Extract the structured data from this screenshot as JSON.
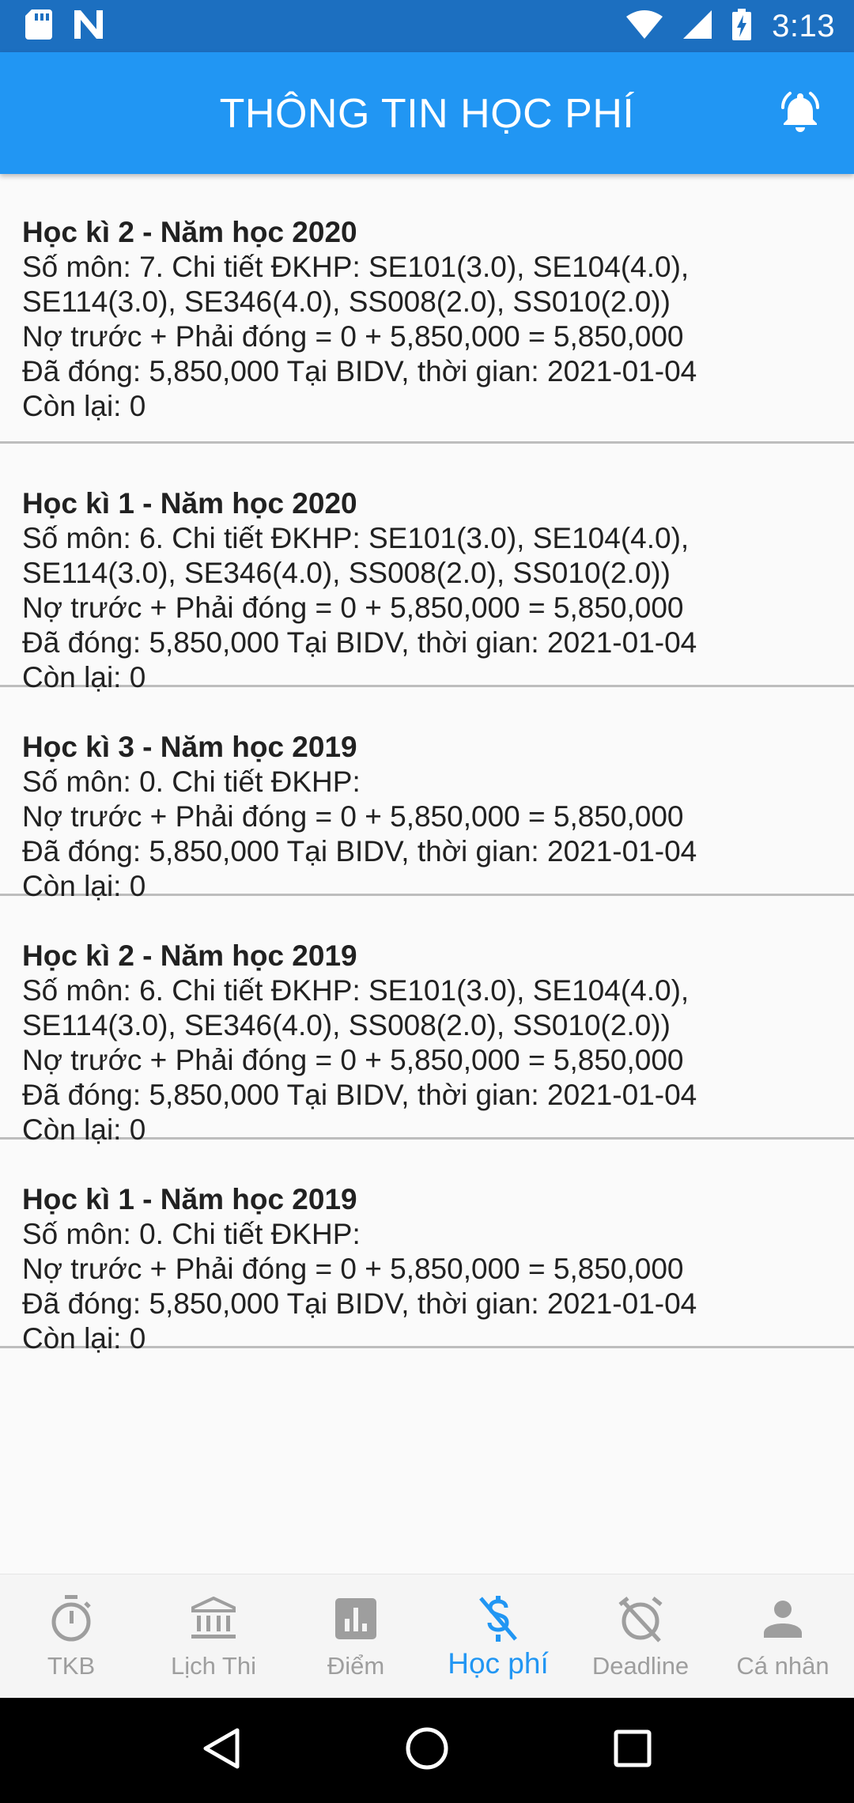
{
  "status_bar": {
    "time": "3:13",
    "icons": [
      "sd-card-icon",
      "n-notification-icon",
      "wifi-icon",
      "signal-icon",
      "battery-charging-icon"
    ]
  },
  "app_bar": {
    "title": "THÔNG TIN HỌC PHÍ",
    "action_icon": "bell-ring-icon"
  },
  "fees": [
    {
      "title": "Học kì 2 - Năm học 2020",
      "lines": [
        "Số môn: 7. Chi tiết ĐKHP: SE101(3.0), SE104(4.0),",
        "SE114(3.0), SE346(4.0), SS008(2.0), SS010(2.0))",
        "Nợ trước + Phải đóng = 0 + 5,850,000 = 5,850,000",
        "Đã đóng: 5,850,000 Tại BIDV, thời gian: 2021-01-04",
        "Còn lại: 0"
      ]
    },
    {
      "title": "Học kì 1 - Năm học 2020",
      "lines": [
        "Số môn: 6. Chi tiết ĐKHP: SE101(3.0), SE104(4.0),",
        "SE114(3.0), SE346(4.0), SS008(2.0), SS010(2.0))",
        "Nợ trước + Phải đóng = 0 + 5,850,000 = 5,850,000",
        "Đã đóng: 5,850,000 Tại BIDV, thời gian: 2021-01-04",
        "Còn lại: 0"
      ]
    },
    {
      "title": "Học kì 3 - Năm học 2019",
      "lines": [
        "Số môn: 0. Chi tiết ĐKHP:",
        "Nợ trước + Phải đóng = 0 + 5,850,000 = 5,850,000",
        "Đã đóng: 5,850,000 Tại BIDV, thời gian: 2021-01-04",
        "Còn lại: 0"
      ]
    },
    {
      "title": "Học kì 2 - Năm học 2019",
      "lines": [
        "Số môn: 6. Chi tiết ĐKHP: SE101(3.0), SE104(4.0),",
        "SE114(3.0), SE346(4.0), SS008(2.0), SS010(2.0))",
        "Nợ trước + Phải đóng = 0 + 5,850,000 = 5,850,000",
        "Đã đóng: 5,850,000 Tại BIDV, thời gian: 2021-01-04",
        "Còn lại: 0"
      ]
    },
    {
      "title": "Học kì 1 - Năm học 2019",
      "lines": [
        "Số môn: 0. Chi tiết ĐKHP:",
        "Nợ trước + Phải đóng = 0 + 5,850,000 = 5,850,000",
        "Đã đóng: 5,850,000 Tại BIDV, thời gian: 2021-01-04",
        "Còn lại: 0"
      ]
    }
  ],
  "bottom_nav": {
    "items": [
      {
        "label": "TKB",
        "icon": "timer-icon"
      },
      {
        "label": "Lịch Thi",
        "icon": "bank-icon"
      },
      {
        "label": "Điểm",
        "icon": "chart-icon"
      },
      {
        "label": "Học phí",
        "icon": "money-off-icon"
      },
      {
        "label": "Deadline",
        "icon": "alarm-off-icon"
      },
      {
        "label": "Cá nhân",
        "icon": "person-icon"
      }
    ],
    "active_index": 3
  },
  "colors": {
    "primary": "#2196f3",
    "status_bar": "#1c6fc0",
    "inactive": "#9e9e9e"
  }
}
